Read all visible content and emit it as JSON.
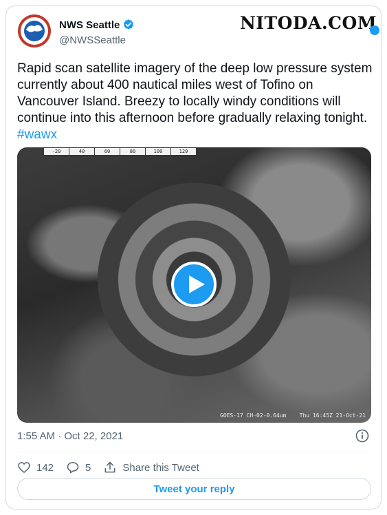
{
  "watermark": "NITODA.COM",
  "author": {
    "name": "NWS Seattle",
    "handle": "@NWSSeattle",
    "verified": true,
    "avatar_icon": "nws-logo-icon"
  },
  "tweet": {
    "text": "Rapid scan satellite imagery of the deep low pressure system currently about 400 nautical miles west of Tofino on Vancouver Island. Breezy to locally windy conditions will continue into this afternoon before gradually relaxing tonight.",
    "hashtag": "#wawx"
  },
  "media": {
    "type": "video",
    "scale_labels": [
      "-20",
      "40",
      "60",
      "80",
      "100",
      "120"
    ],
    "caption": "GOES-17 CH-02-0.64um    Thu 16:45Z 21-Oct-21",
    "play_icon": "play-icon"
  },
  "timestamp": "1:55 AM · Oct 22, 2021",
  "metrics": {
    "likes": "142",
    "replies": "5",
    "share_label": "Share this Tweet"
  },
  "reply_button": "Tweet your reply",
  "colors": {
    "accent": "#1d9bf0",
    "text": "#0f1419",
    "secondary": "#536471",
    "border": "#cfd9de"
  }
}
